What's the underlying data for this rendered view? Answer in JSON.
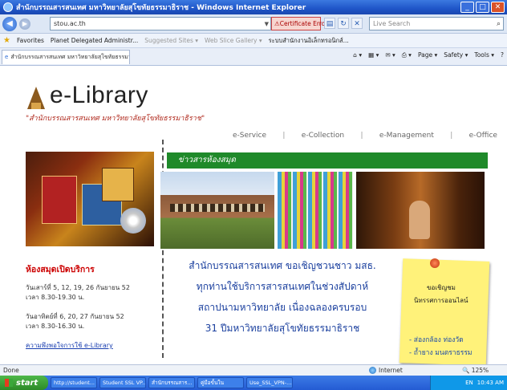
{
  "window": {
    "title": "สำนักบรรณสารสนเทศ มหาวิทยาลัยสุโขทัยธรรมาธิราช - Windows Internet Explorer",
    "buttons": [
      "_",
      "□",
      "✕"
    ]
  },
  "addressbar": {
    "url": "stou.ac.th",
    "cert_error": "Certificate Error",
    "search_placeholder": "Live Search"
  },
  "favorites": {
    "label": "Favorites",
    "items": [
      "Planet Delegated Administr...",
      "Suggested Sites ▾",
      "Web Slice Gallery ▾",
      "ระบบสำนักงานอิเล็กทรอนิกส์..."
    ]
  },
  "tab": {
    "label": "สำนักบรรณสารสนเทศ มหาวิทยาลัยสุโขทัยธรรมาธิราช"
  },
  "commandbar": [
    "Page ▾",
    "Safety ▾",
    "Tools ▾"
  ],
  "page": {
    "logo_text": "e-Library",
    "subtitle": "\"สำนักบรรณสารสนเทศ มหาวิทยาลัยสุโขทัยธรรมาธิราช\"",
    "nav": [
      "e-Service",
      "e-Collection",
      "e-Management",
      "e-Office"
    ],
    "news_header": "ข่าวสารห้องสมุด",
    "open_title": "ห้องสมุดเปิดบริการ",
    "open_lines": [
      "วันเสาร์ที่ 5, 12, 19, 26 กันยายน 52",
      "เวลา 8.30-19.30 น.",
      "วันอาทิตย์ที่ 6, 20, 27 กันยายน 52",
      "เวลา 8.30-16.30 น."
    ],
    "satisfaction_link": "ความพึงพอใจการใช้ e-Library",
    "main_text": [
      "สำนักบรรณสารสนเทศ ขอเชิญชวนชาว มสธ.",
      "ทุกท่านใช้บริการสารสนเทศในช่วงสัปดาห์",
      "สถาปนามหาวิทยาลัย เนื่องฉลองครบรอบ",
      "31 ปีมหาวิทยาลัยสุโขทัยธรรมาธิราช"
    ],
    "sticky": [
      "ขอเชิญชม",
      "นิทรรศการออนไลน์",
      "- ส่องกล้อง ท่องวัด",
      "- ถ้ำยาง มนตราธรรม"
    ]
  },
  "statusbar": {
    "status": "Done",
    "zone": "Internet",
    "zoom": "125%"
  },
  "taskbar": {
    "start": "start",
    "tasks": [
      "http://student...",
      "Student SSL VP...",
      "สำนักบรรณสาร...",
      "คู่มือขั้นใน",
      "Use_SSL_VPN-...."
    ],
    "tray_lang": "EN",
    "clock": "10:43 AM"
  }
}
